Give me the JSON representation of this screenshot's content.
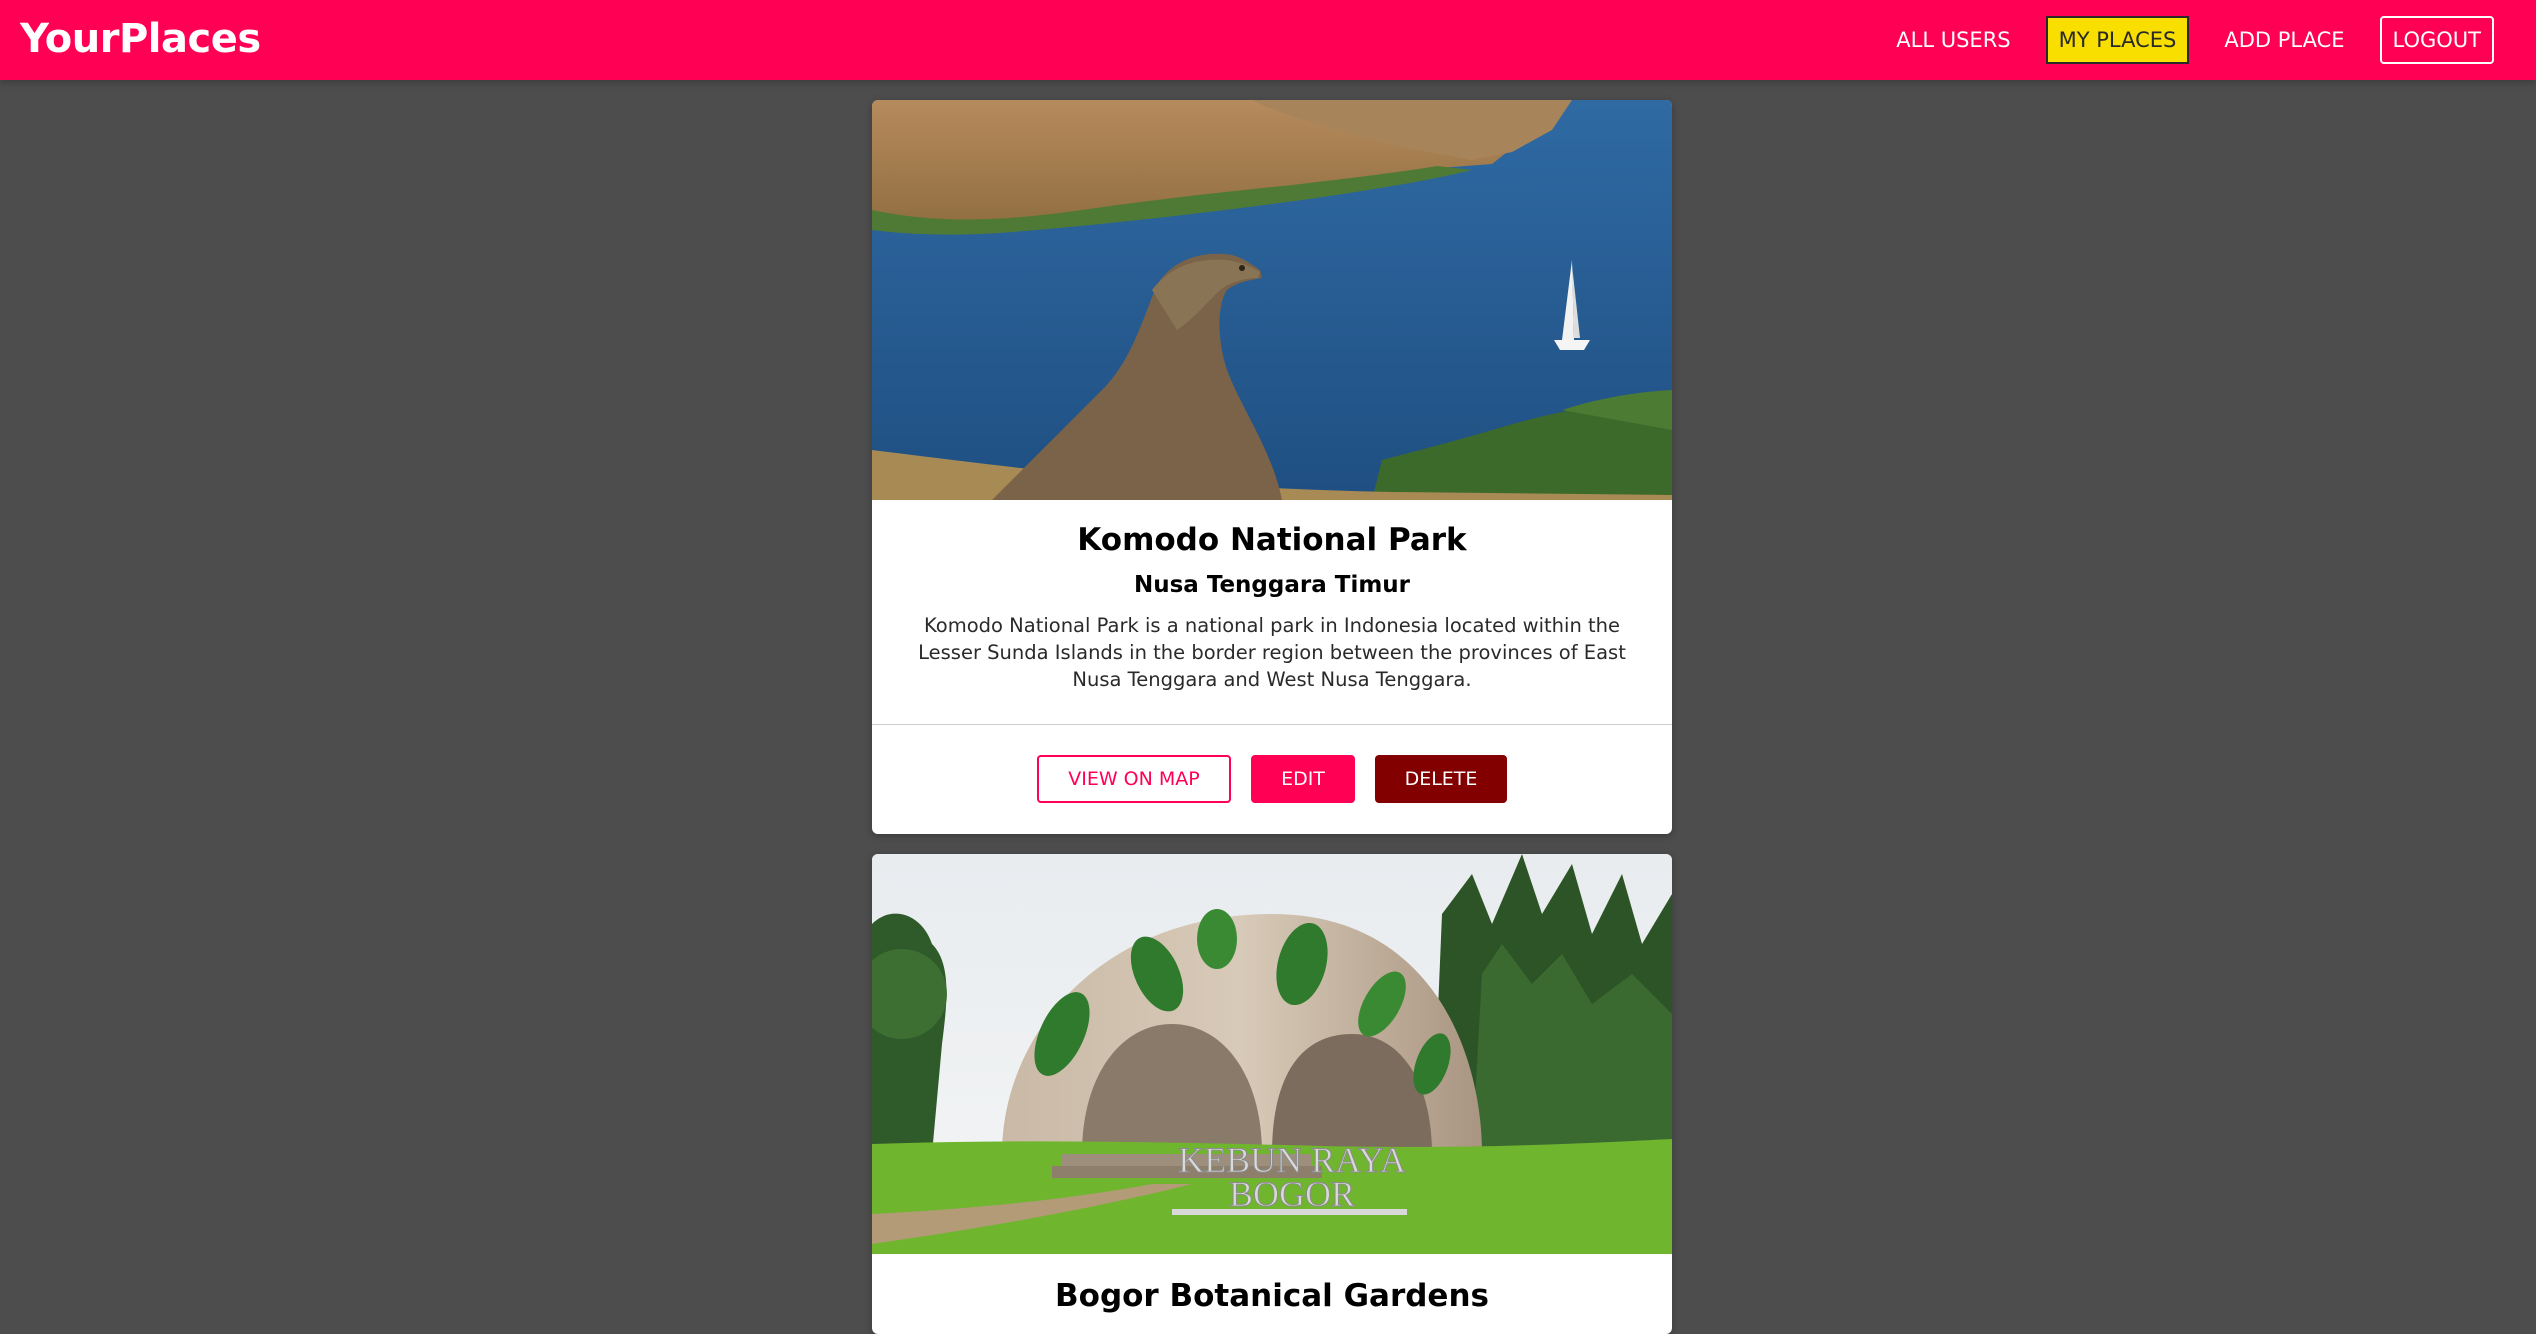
{
  "app": {
    "title": "YourPlaces"
  },
  "nav": {
    "all_users": "ALL USERS",
    "my_places": "MY PLACES",
    "add_place": "ADD PLACE",
    "logout": "LOGOUT"
  },
  "places": [
    {
      "title": "Komodo National Park",
      "address": "Nusa Tenggara Timur",
      "description": "Komodo National Park is a national park in Indonesia located within the Lesser Sunda Islands in the border region between the provinces of East Nusa Tenggara and West Nusa Tenggara.",
      "actions": {
        "view_on_map": "VIEW ON MAP",
        "edit": "EDIT",
        "delete": "DELETE"
      }
    },
    {
      "title": "Bogor Botanical Gardens",
      "image_sign_text": "KEBUN RAYA BOGOR"
    }
  ],
  "colors": {
    "brand": "#ff0055",
    "active_nav": "#f8df00",
    "danger": "#830000",
    "background": "#4d4d4d"
  }
}
